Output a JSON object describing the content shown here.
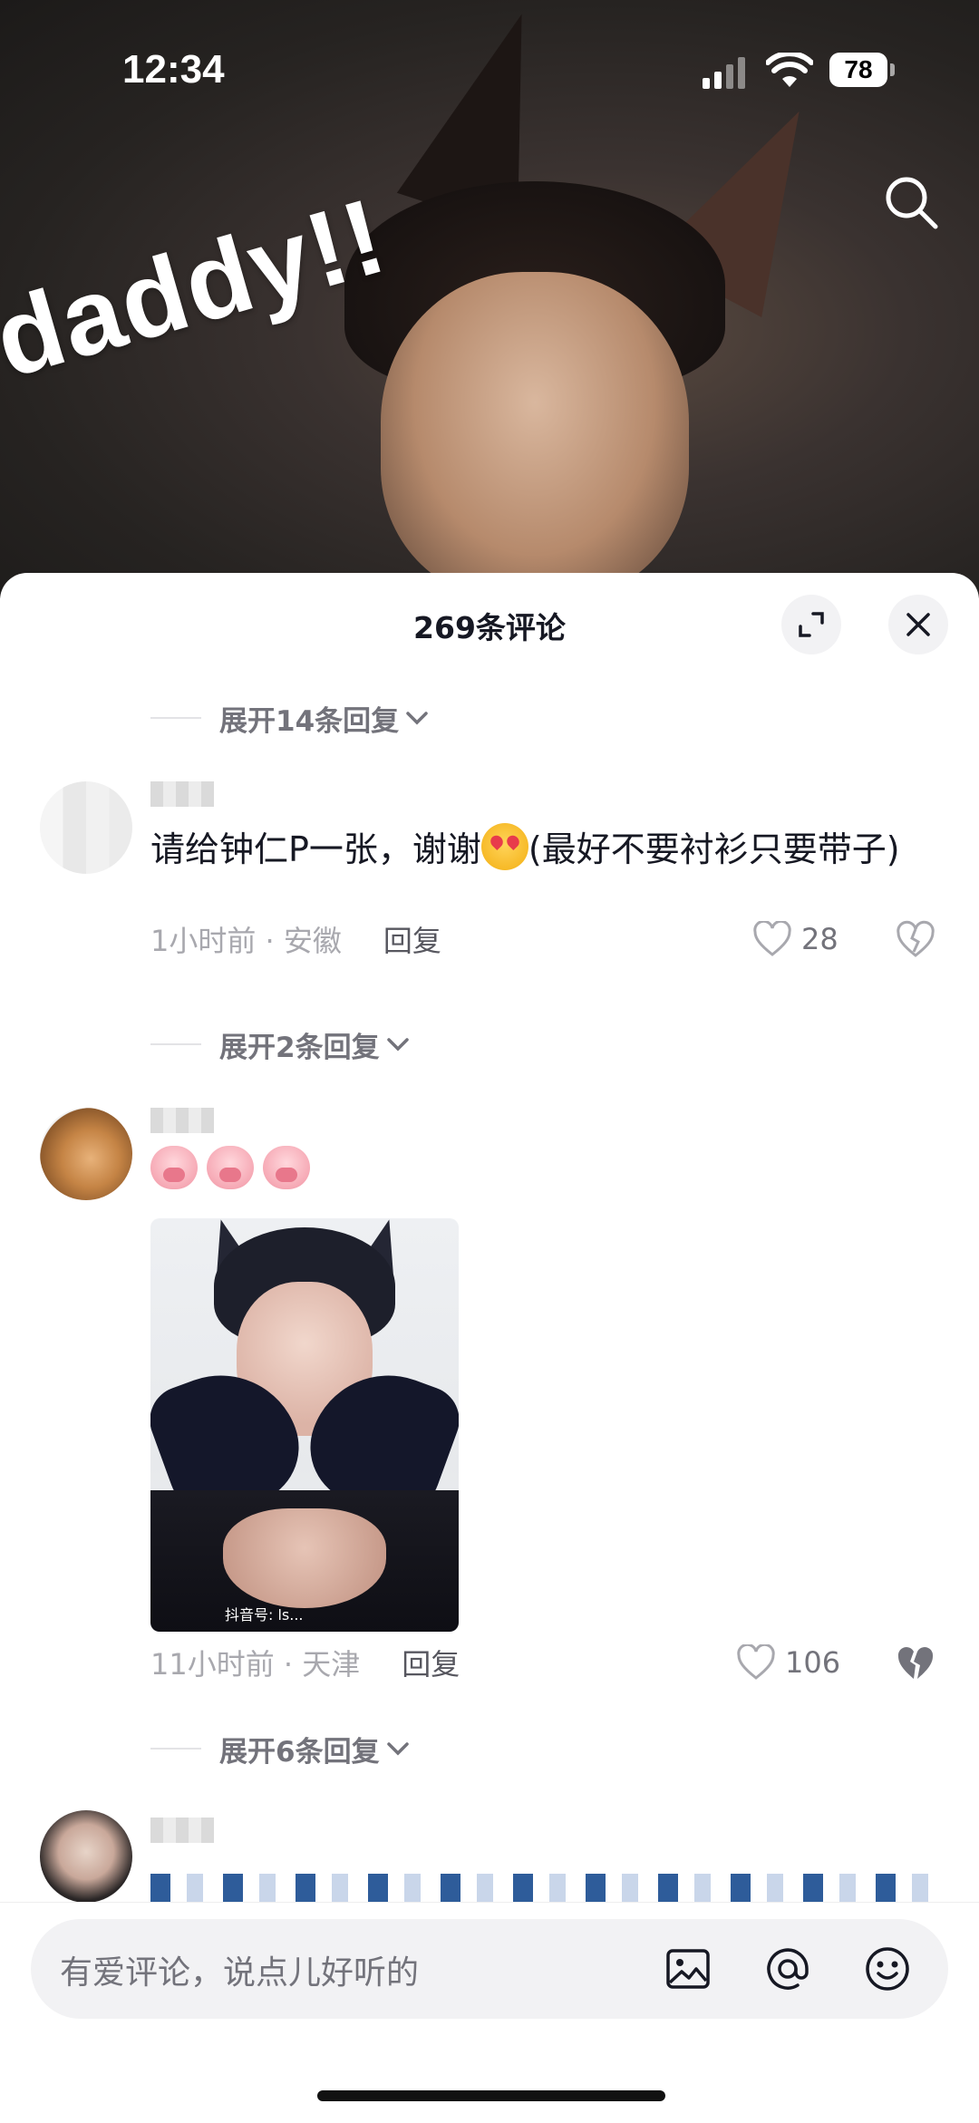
{
  "status_bar": {
    "time": "12:34",
    "battery": "78"
  },
  "video": {
    "caption": "daddy!!"
  },
  "panel": {
    "title": "269条评论",
    "expand_icon": "expand-icon",
    "close_icon": "close-icon"
  },
  "comments": [
    {
      "expand_before": "展开14条回复",
      "text_before_emoji": "请给钟仁P一张，谢谢",
      "emoji": "heart-eyes-emoji",
      "text_after_emoji": "(最好不要衬衫只要带子)",
      "time_location": "1小时前 · 安徽",
      "reply_label": "回复",
      "likes": "28"
    },
    {
      "expand_before": "展开2条回复",
      "stickers": [
        "pig-emoji",
        "pig-emoji",
        "pig-emoji"
      ],
      "image_tag": "抖音号: ls...",
      "time_location": "11小时前 · 天津",
      "reply_label": "回复",
      "likes": "106"
    },
    {
      "expand_before": "展开6条回复"
    }
  ],
  "input": {
    "placeholder": "有爱评论，说点儿好听的",
    "icons": [
      "image-icon",
      "at-icon",
      "emoji-icon"
    ]
  }
}
